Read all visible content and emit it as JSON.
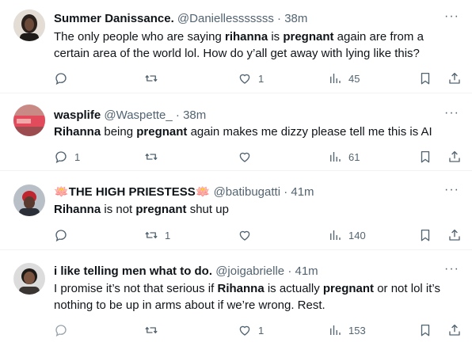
{
  "tweets": [
    {
      "name": "Summer Danissance.",
      "handle": "@Daniellesssssss",
      "time": "38m",
      "text_parts": [
        "The only people who are saying ",
        "rihanna",
        " is ",
        "pregnant",
        " again are from a certain area of the world lol. How do y’all get away with lying like this?"
      ],
      "reply_count": "",
      "retweet_count": "",
      "like_count": "1",
      "view_count": "45"
    },
    {
      "name": "wasplife",
      "handle": "@Waspette_",
      "time": "38m",
      "text_parts": [
        "Rihanna",
        " being ",
        "pregnant",
        " again makes me dizzy please tell me this is AI"
      ],
      "reply_count": "1",
      "retweet_count": "",
      "like_count": "",
      "view_count": "61"
    },
    {
      "name_emoji": "🪷",
      "name": "THE HIGH PRIESTESS",
      "handle": "@batibugatti",
      "time": "41m",
      "text_parts": [
        "Rihanna",
        " is not ",
        "pregnant",
        " shut up"
      ],
      "reply_count": "",
      "retweet_count": "1",
      "like_count": "",
      "view_count": "140"
    },
    {
      "name": "i like telling men what to do.",
      "handle": "@joigabrielle",
      "time": "41m",
      "text_parts": [
        "I promise it’s not that serious if ",
        "Rihanna",
        " is actually ",
        "pregnant",
        " or not lol it’s nothing to be up in arms about if we’re wrong. Rest."
      ],
      "reply_count": "",
      "retweet_count": "",
      "like_count": "1",
      "view_count": "153"
    }
  ],
  "separator": "·",
  "more_label": "···",
  "icons": {
    "reply": "reply-icon",
    "retweet": "retweet-icon",
    "like": "like-icon",
    "views": "views-icon",
    "bookmark": "bookmark-icon",
    "share": "share-icon",
    "more": "more-icon"
  },
  "colors": {
    "text": "#0f1419",
    "secondary": "#536471",
    "divider": "#eff3f4",
    "lotus": "#e0245e"
  }
}
